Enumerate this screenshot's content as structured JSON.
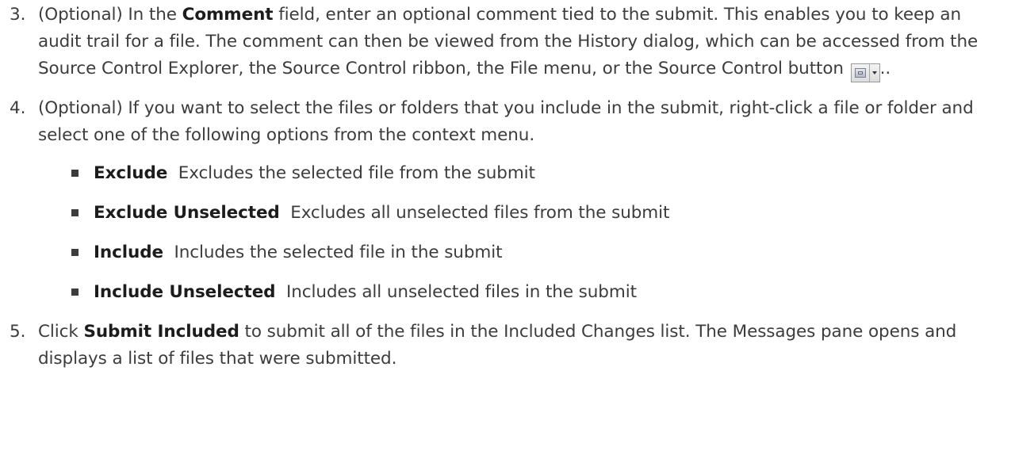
{
  "steps": [
    {
      "number": "3.",
      "parts": [
        "(Optional) In the ",
        "Comment",
        " field, enter an optional comment tied to the submit. This enables you to keep an audit trail for a file. The comment can then be viewed from the History dialog, which can be accessed from the Source Control Explorer, the Source Control ribbon, the File menu, or the Source Control button ",
        ".."
      ]
    },
    {
      "number": "4.",
      "text": "(Optional) If you want to select the files or folders that you include in the submit, right-click a file or folder and select one of the following options from the context menu.",
      "options": [
        {
          "term": "Exclude",
          "desc": "Excludes the selected file from the submit"
        },
        {
          "term": "Exclude Unselected",
          "desc": "Excludes all unselected files from the submit"
        },
        {
          "term": "Include",
          "desc": "Includes the selected file in the submit"
        },
        {
          "term": "Include Unselected",
          "desc": "Includes all unselected files in the submit"
        }
      ]
    },
    {
      "number": "5.",
      "parts": [
        "Click ",
        "Submit Included",
        " to submit all of the files in the Included Changes list. The Messages pane opens and displays a list of files that were submitted."
      ]
    }
  ],
  "icons": {
    "source_control_button": "source-control-icon",
    "dropdown": "chevron-down-icon",
    "bullet": "square-bullet-icon"
  }
}
